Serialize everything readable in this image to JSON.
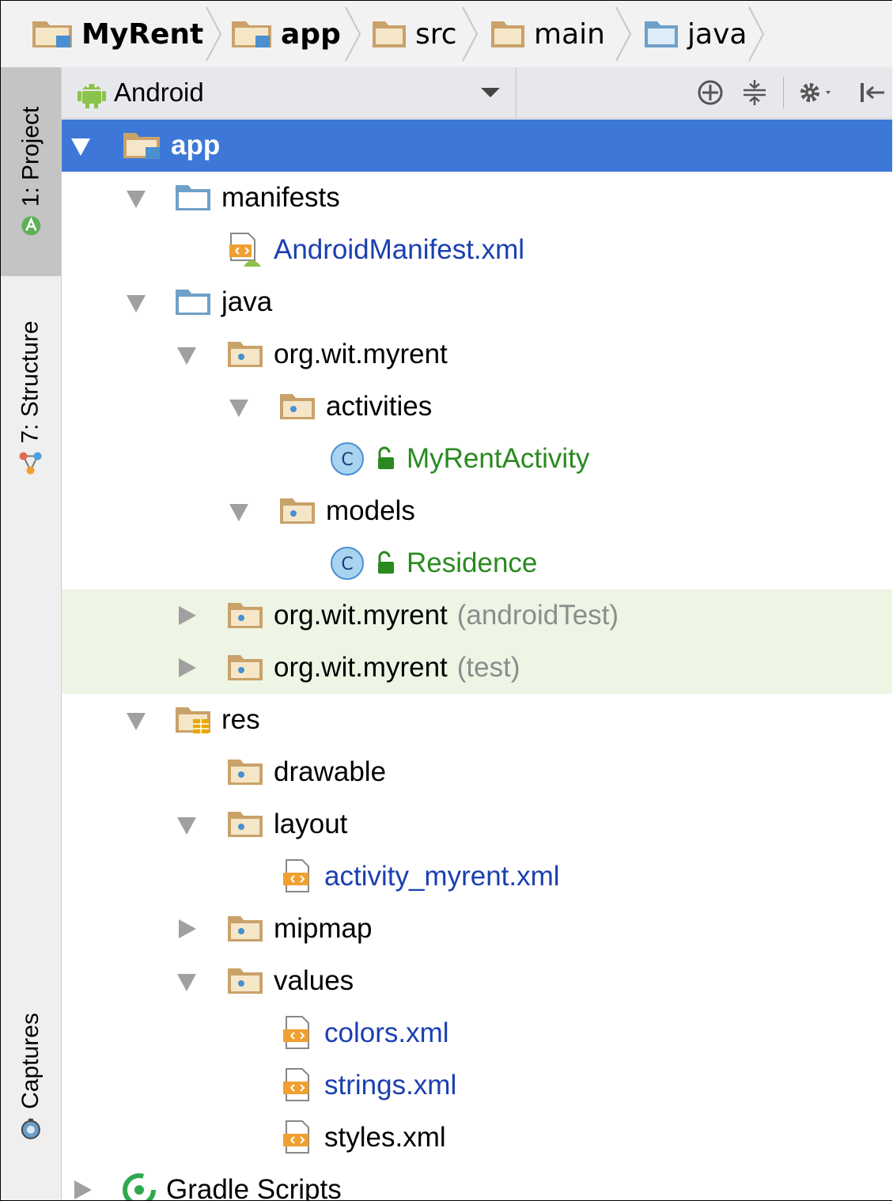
{
  "breadcrumb": {
    "items": [
      {
        "label": "MyRent",
        "bold": true
      },
      {
        "label": "app",
        "bold": true
      },
      {
        "label": "src",
        "bold": false
      },
      {
        "label": "main",
        "bold": false
      },
      {
        "label": "java",
        "bold": false
      }
    ]
  },
  "tool_strip": {
    "project_tab": {
      "number": "1",
      "label": "1: Project"
    },
    "structure_tab": {
      "label": "7: Structure"
    },
    "captures_tab": {
      "label": "Captures"
    }
  },
  "toolbar": {
    "view_mode": "Android",
    "icons": [
      "locate-icon",
      "collapse-all-icon",
      "settings-icon",
      "hide-icon"
    ]
  },
  "tree": {
    "app": "app",
    "manifests": "manifests",
    "android_manifest": "AndroidManifest.xml",
    "java": "java",
    "pkg_main": "org.wit.myrent",
    "activities": "activities",
    "myrent_activity": "MyRentActivity",
    "models": "models",
    "residence": "Residence",
    "pkg_android_test": "org.wit.myrent",
    "android_test_suffix": "(androidTest)",
    "pkg_test": "org.wit.myrent",
    "test_suffix": "(test)",
    "res": "res",
    "drawable": "drawable",
    "layout": "layout",
    "activity_myrent_xml": "activity_myrent.xml",
    "mipmap": "mipmap",
    "values": "values",
    "colors_xml": "colors.xml",
    "strings_xml": "strings.xml",
    "styles_xml": "styles.xml",
    "gradle_scripts": "Gradle Scripts"
  },
  "colors": {
    "selection": "#3d78d8",
    "test_highlight": "#eef5e5",
    "resource_file_text": "#1a3fb0",
    "class_text": "#2a8a1f"
  }
}
